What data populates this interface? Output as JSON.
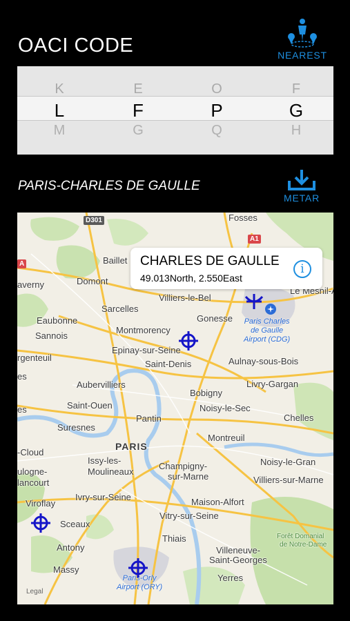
{
  "header": {
    "title": "OACI CODE",
    "nearest_label": "NEAREST"
  },
  "picker": {
    "columns": [
      {
        "prev": "K",
        "current": "L",
        "next": "M"
      },
      {
        "prev": "E",
        "current": "F",
        "next": "G"
      },
      {
        "prev": "O",
        "current": "P",
        "next": "Q"
      },
      {
        "prev": "F",
        "current": "G",
        "next": "H"
      }
    ]
  },
  "airport": {
    "name": "PARIS-CHARLES DE GAULLE",
    "metar_label": "METAR"
  },
  "map": {
    "callout": {
      "title": "CHARLES DE GAULLE",
      "coords": "49.013North, 2.550East"
    },
    "roads": {
      "d301": "D301",
      "a1": "A1",
      "a4": "A"
    },
    "towns": {
      "fosses": "Fosses",
      "baillet": "Baillet",
      "domont": "Domont",
      "averny": "averny",
      "villiers_le_bel": "Villiers-le-Bel",
      "le_mesnil": "Le Mesnil-A",
      "sarcelles": "Sarcelles",
      "gonesse": "Gonesse",
      "eaubonne": "Eaubonne",
      "montmorency": "Montmorency",
      "sannois": "Sannois",
      "epinay": "Epinay-sur-Seine",
      "argenteuil": "rgenteuil",
      "saint_denis": "Saint-Denis",
      "aulnay": "Aulnay-sous-Bois",
      "es": "es",
      "livry": "Livry-Gargan",
      "aubervilliers": "Aubervilliers",
      "bobigny": "Bobigny",
      "saint_ouen": "Saint-Ouen",
      "noisy_le_sec": "Noisy-le-Sec",
      "chelles": "Chelles",
      "suresnes": "Suresnes",
      "pantin": "Pantin",
      "paris": "PARIS",
      "montreuil": "Montreuil",
      "cloud": "-Cloud",
      "noisy_le_grand": "Noisy-le-Gran",
      "issy": "Issy-les-",
      "moulineaux": "Moulineaux",
      "champigny": "Champigny-",
      "sur_marne": "sur-Marne",
      "boulogne": "ulogne-",
      "billancourt": "lancourt",
      "villiers_sur_marne": "Villiers-sur-Marne",
      "viroflay": "Viroflay",
      "ivry": "Ivry-sur-Seine",
      "maisons_alfort": "Maison-Alfort",
      "sceaux": "Sceaux",
      "vitry": "Vitry-sur-Seine",
      "antony": "Antony",
      "thiais": "Thiais",
      "villeneuve": "Villeneuve-",
      "saint_georges": "Saint-Georges",
      "massy": "Massy",
      "yerres": "Yerres",
      "foret1": "Forêt Domanial",
      "foret2": "de Notre-Dame",
      "cdg1": "Paris Charles",
      "cdg2": "de Gaulle",
      "cdg3": "Airport (CDG)",
      "ory1": "Paris-Orly",
      "ory2": "Airport (ORY)"
    },
    "legal": "Legal",
    "marker_icon": "crosshair-airport-icon"
  },
  "colors": {
    "accent": "#1e8fe0",
    "marker": "#1515c8"
  }
}
